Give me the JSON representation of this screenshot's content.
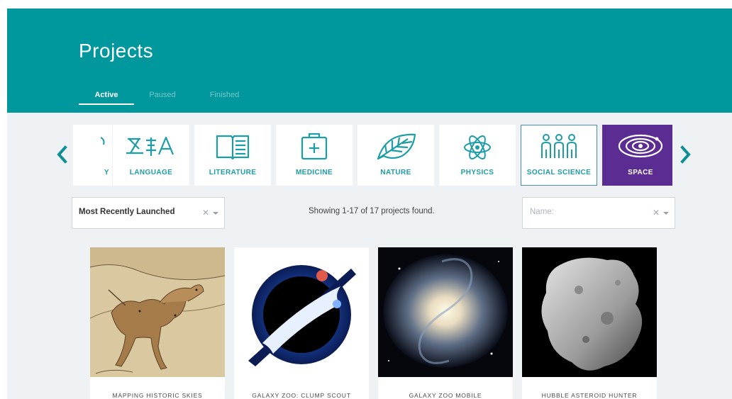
{
  "header": {
    "title": "Projects",
    "tabs": [
      {
        "label": "Active",
        "active": true
      },
      {
        "label": "Paused",
        "active": false
      },
      {
        "label": "Finished",
        "active": false
      }
    ]
  },
  "categories": [
    {
      "label": "Y",
      "icon": "partial-icon"
    },
    {
      "label": "LANGUAGE",
      "icon": "language-icon"
    },
    {
      "label": "LITERATURE",
      "icon": "book-icon"
    },
    {
      "label": "MEDICINE",
      "icon": "medical-kit-icon"
    },
    {
      "label": "NATURE",
      "icon": "leaf-icon"
    },
    {
      "label": "PHYSICS",
      "icon": "atom-icon"
    },
    {
      "label": "SOCIAL SCIENCE",
      "icon": "people-icon"
    },
    {
      "label": "SPACE",
      "icon": "solar-system-icon",
      "selected": true
    }
  ],
  "filters": {
    "sort": {
      "value": "Most Recently Launched"
    },
    "results_text": "Showing 1-17 of 17 projects found.",
    "name": {
      "placeholder": "Name:"
    }
  },
  "projects": [
    {
      "title": "MAPPING HISTORIC SKIES",
      "image": "star-chart-unicorn"
    },
    {
      "title": "GALAXY ZOO: CLUMP SCOUT",
      "image": "clump-scout-logo"
    },
    {
      "title": "GALAXY ZOO MOBILE",
      "image": "spiral-galaxy"
    },
    {
      "title": "HUBBLE ASTEROID HUNTER",
      "image": "asteroid"
    }
  ],
  "colors": {
    "header_bg": "#00979d",
    "accent": "#1c9da6",
    "selected_category": "#5b2d93",
    "page_bg": "#eff2f5"
  }
}
